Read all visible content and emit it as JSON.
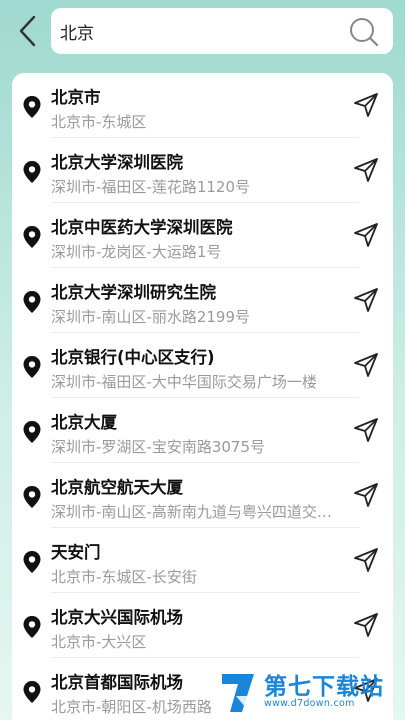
{
  "search": {
    "value": "北京"
  },
  "results": [
    {
      "title": "北京市",
      "address": "北京市-东城区"
    },
    {
      "title": "北京大学深圳医院",
      "address": "深圳市-福田区-莲花路1120号"
    },
    {
      "title": "北京中医药大学深圳医院",
      "address": "深圳市-龙岗区-大运路1号"
    },
    {
      "title": "北京大学深圳研究生院",
      "address": "深圳市-南山区-丽水路2199号"
    },
    {
      "title": "北京银行(中心区支行)",
      "address": "深圳市-福田区-大中华国际交易广场一楼"
    },
    {
      "title": "北京大厦",
      "address": "深圳市-罗湖区-宝安南路3075号"
    },
    {
      "title": "北京航空航天大厦",
      "address": "深圳市-南山区-高新南九道与粤兴四道交汇处"
    },
    {
      "title": "天安门",
      "address": "北京市-东城区-长安街"
    },
    {
      "title": "北京大兴国际机场",
      "address": "北京市-大兴区"
    },
    {
      "title": "北京首都国际机场",
      "address": "北京市-朝阳区-机场西路"
    }
  ],
  "watermark": {
    "name": "第七下载站",
    "url": "www.d7down.com"
  },
  "colors": {
    "background_top": "#9fd9cf",
    "accent_cursor": "#2aa6e6",
    "watermark": "#1a86d9"
  },
  "icons": {
    "back": "chevron-left-icon",
    "search": "search-icon",
    "pin": "location-pin-icon",
    "navigate": "navigate-arrow-icon"
  }
}
